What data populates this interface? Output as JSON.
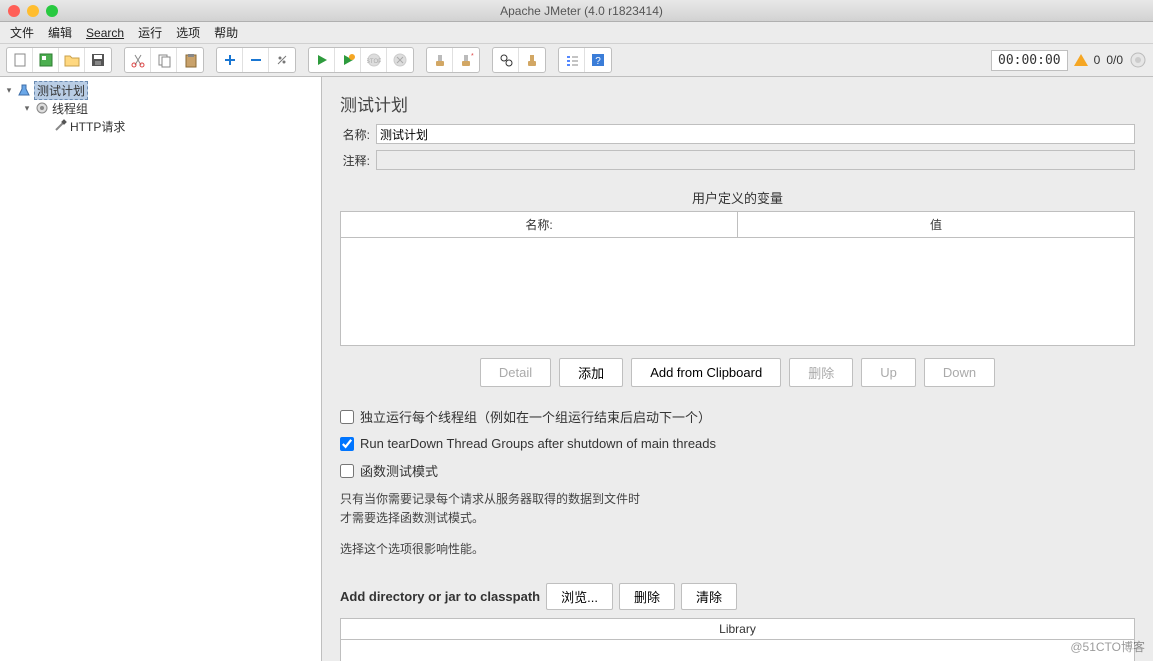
{
  "window": {
    "title": "Apache JMeter (4.0 r1823414)"
  },
  "menus": {
    "file": "文件",
    "edit": "编辑",
    "search": "Search",
    "run": "运行",
    "options": "选项",
    "help": "帮助"
  },
  "status": {
    "timer": "00:00:00",
    "warn_count": "0",
    "threads": "0/0"
  },
  "tree": {
    "root": {
      "label": "测试计划"
    },
    "thread_group": {
      "label": "线程组"
    },
    "http": {
      "label": "HTTP请求"
    }
  },
  "panel": {
    "title": "测试计划",
    "name_label": "名称:",
    "name_value": "测试计划",
    "comment_label": "注释:",
    "vars_title": "用户定义的变量",
    "vars_cols": {
      "name": "名称:",
      "value": "值"
    },
    "buttons": {
      "detail": "Detail",
      "add": "添加",
      "from_clip": "Add from Clipboard",
      "delete": "删除",
      "up": "Up",
      "down": "Down"
    },
    "chk_serial": "独立运行每个线程组（例如在一个组运行结束后启动下一个）",
    "chk_teardown": "Run tearDown Thread Groups after shutdown of main threads",
    "chk_func": "函数测试模式",
    "note1": "只有当你需要记录每个请求从服务器取得的数据到文件时",
    "note2": "才需要选择函数测试模式。",
    "note3": "选择这个选项很影响性能。",
    "classpath_label": "Add directory or jar to classpath",
    "cp_buttons": {
      "browse": "浏览...",
      "delete": "删除",
      "clear": "清除"
    },
    "library_header": "Library"
  },
  "watermark": "@51CTO博客"
}
